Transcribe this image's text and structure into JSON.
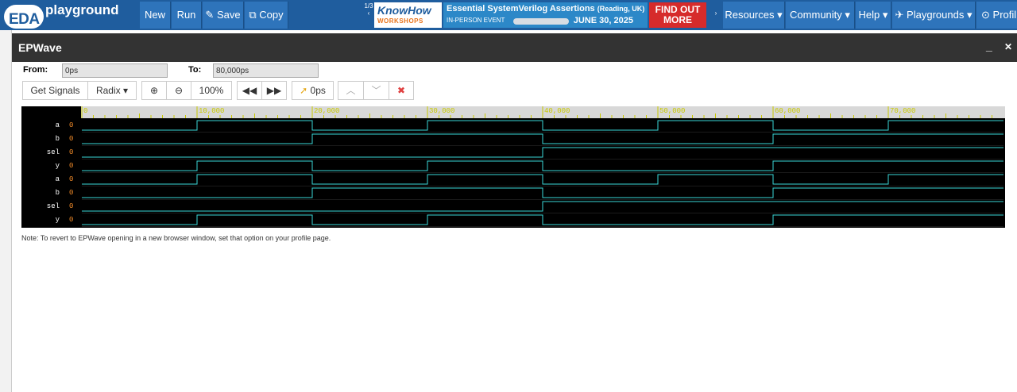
{
  "navbar": {
    "logo_eda": "EDA",
    "logo_playground": "playground",
    "buttons": {
      "new": "New",
      "run": "Run",
      "save": "Save",
      "copy": "Copy"
    },
    "ad": {
      "counter": "1/3",
      "know_how": "KnowHow",
      "workshops": "WORKSHOPS",
      "title": "Essential SystemVerilog Assertions",
      "location": "(Reading, UK)",
      "event": "IN-PERSON EVENT",
      "date": "JUNE 30, 2025",
      "find_out": "FIND OUT",
      "more": "MORE"
    },
    "menu": {
      "resources": "Resources",
      "community": "Community",
      "help": "Help",
      "playgrounds": "Playgrounds",
      "profile": "Profil"
    }
  },
  "window": {
    "title": "EPWave",
    "minimize": "_",
    "close": "✕"
  },
  "controls": {
    "from_label": "From:",
    "from_value": "0ps",
    "to_label": "To:",
    "to_value": "80,000ps",
    "get_signals": "Get Signals",
    "radix": "Radix",
    "zoom": "100%",
    "cursor": "0ps"
  },
  "wave": {
    "time_end": 80000,
    "ticks": [
      "0",
      "10,000",
      "20,000",
      "30,000",
      "40,000",
      "50,000",
      "60,000",
      "70,000"
    ],
    "signals": [
      {
        "name": "a",
        "value": "0",
        "transitions": [
          0,
          10000,
          20000,
          30000,
          40000,
          50000,
          60000,
          70000,
          80000
        ],
        "start_high": false
      },
      {
        "name": "b",
        "value": "0",
        "transitions": [
          0,
          20000,
          40000,
          60000,
          80000
        ],
        "start_high": false
      },
      {
        "name": "sel",
        "value": "0",
        "transitions": [
          0,
          40000,
          80000
        ],
        "start_high": false
      },
      {
        "name": "y",
        "value": "0",
        "transitions": [
          0,
          10000,
          20000,
          30000,
          40000,
          60000,
          80000
        ],
        "start_high": false
      },
      {
        "name": "a",
        "value": "0",
        "transitions": [
          0,
          10000,
          20000,
          30000,
          40000,
          50000,
          60000,
          70000,
          80000
        ],
        "start_high": false
      },
      {
        "name": "b",
        "value": "0",
        "transitions": [
          0,
          20000,
          40000,
          60000,
          80000
        ],
        "start_high": false
      },
      {
        "name": "sel",
        "value": "0",
        "transitions": [
          0,
          40000,
          80000
        ],
        "start_high": false
      },
      {
        "name": "y",
        "value": "0",
        "transitions": [
          0,
          10000,
          20000,
          30000,
          40000,
          60000,
          80000
        ],
        "start_high": false
      }
    ]
  },
  "note": "Note: To revert to EPWave opening in a new browser window, set that option on your profile page.",
  "colors": {
    "navbar": "#1f5d9e",
    "wave_line": "#3ad7d7",
    "wave_bg": "#000000",
    "tick": "#c8c800"
  }
}
